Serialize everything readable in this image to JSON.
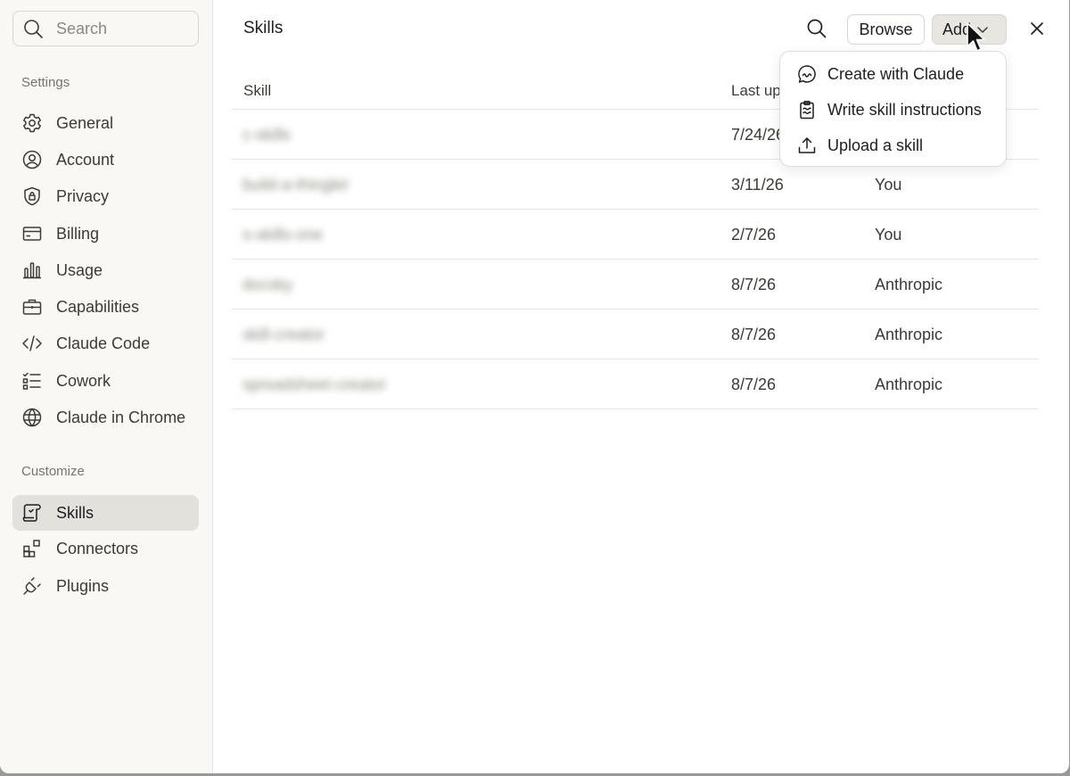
{
  "sidebar": {
    "search_placeholder": "Search",
    "settings_label": "Settings",
    "customize_label": "Customize",
    "settings_items": [
      {
        "label": "General",
        "icon": "gear-icon"
      },
      {
        "label": "Account",
        "icon": "user-circle-icon"
      },
      {
        "label": "Privacy",
        "icon": "shield-lock-icon"
      },
      {
        "label": "Billing",
        "icon": "credit-card-icon"
      },
      {
        "label": "Usage",
        "icon": "bar-chart-icon"
      },
      {
        "label": "Capabilities",
        "icon": "briefcase-icon"
      },
      {
        "label": "Claude Code",
        "icon": "code-icon"
      },
      {
        "label": "Cowork",
        "icon": "checklist-icon"
      },
      {
        "label": "Claude in Chrome",
        "icon": "globe-icon"
      }
    ],
    "customize_items": [
      {
        "label": "Skills",
        "icon": "scroll-icon",
        "active": true
      },
      {
        "label": "Connectors",
        "icon": "connectors-icon"
      },
      {
        "label": "Plugins",
        "icon": "plug-icon"
      }
    ]
  },
  "main": {
    "title": "Skills",
    "browse_label": "Browse",
    "add_label": "Add",
    "table": {
      "headers": [
        "Skill",
        "Last up"
      ],
      "rows": [
        {
          "name": "c-skills",
          "date": "7/24/26",
          "author": ""
        },
        {
          "name": "build-a-thinglet",
          "date": "3/11/26",
          "author": "You"
        },
        {
          "name": "s-skills-one",
          "date": "2/7/26",
          "author": "You"
        },
        {
          "name": "docsky",
          "date": "8/7/26",
          "author": "Anthropic"
        },
        {
          "name": "skill-creator",
          "date": "8/7/26",
          "author": "Anthropic"
        },
        {
          "name": "spreadsheet-creator",
          "date": "8/7/26",
          "author": "Anthropic"
        }
      ]
    }
  },
  "dropdown": {
    "items": [
      {
        "label": "Create with Claude",
        "icon": "chat-bubble-icon"
      },
      {
        "label": "Write skill instructions",
        "icon": "clipboard-icon"
      },
      {
        "label": "Upload a skill",
        "icon": "upload-icon"
      }
    ]
  }
}
